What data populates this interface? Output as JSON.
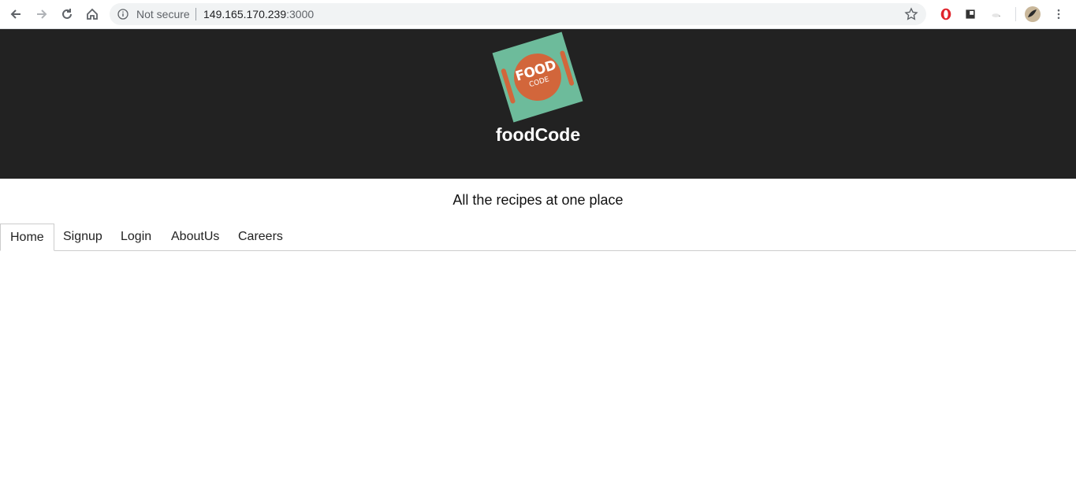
{
  "browser": {
    "security_label": "Not secure",
    "url_host": "149.165.170.239",
    "url_port": ":3000"
  },
  "header": {
    "logo_text_top": "FOOD",
    "logo_text_bottom": "CODE",
    "site_title": "foodCode"
  },
  "tagline": "All the recipes at one place",
  "tabs": [
    {
      "label": "Home",
      "active": true
    },
    {
      "label": "Signup",
      "active": false
    },
    {
      "label": "Login",
      "active": false
    },
    {
      "label": "AboutUs",
      "active": false
    },
    {
      "label": "Careers",
      "active": false
    }
  ],
  "colors": {
    "header_bg": "#222222",
    "logo_green": "#6dbb9b",
    "logo_orange": "#d2663b"
  }
}
